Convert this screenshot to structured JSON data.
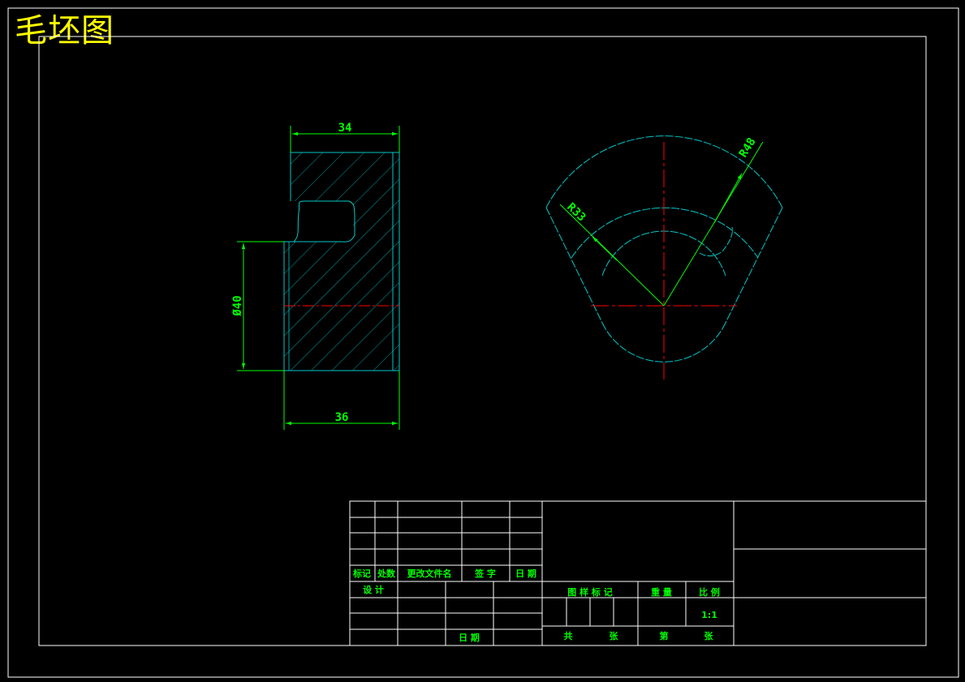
{
  "title": "毛坯图",
  "colors": {
    "background": "#000000",
    "frame": "#ffffff",
    "outline": "#00c8c8",
    "dimension": "#00ff00",
    "centerline": "#ff0000",
    "title": "#ffff00"
  },
  "dimensions": {
    "top_width": "34",
    "bottom_width": "36",
    "diameter": "Ø40",
    "inner_radius": "R33",
    "outer_radius": "R48"
  },
  "title_block": {
    "revision_headers": [
      "标记",
      "处数",
      "更改文件名",
      "签 字",
      "日 期"
    ],
    "design": "设 计",
    "date": "日 期",
    "drawing_mark": "图 样 标 记",
    "weight": "重 量",
    "scale_label": "比 例",
    "scale_value": "1:1",
    "total": "共",
    "sheets": "张",
    "sheet_no": "第",
    "sheet_unit": "张"
  }
}
